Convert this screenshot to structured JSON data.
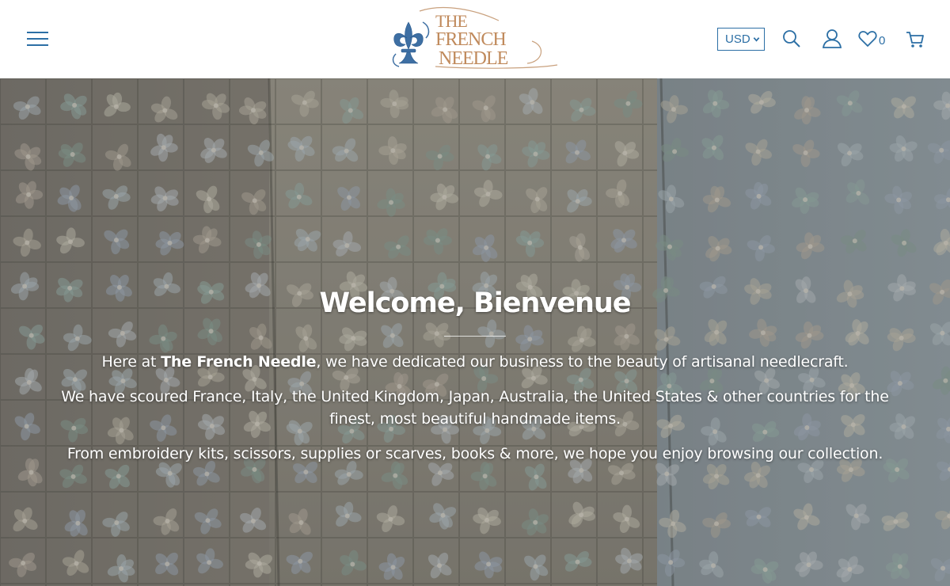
{
  "header": {
    "logo": {
      "line1": "THE",
      "line2": "FRENCH",
      "line3": "NEEDLE",
      "icon": "fleur-de-lis-icon"
    },
    "currency": {
      "selected": "USD"
    },
    "wishlist_count": "0",
    "icons": [
      "menu-icon",
      "search-icon",
      "account-icon",
      "heart-icon",
      "cart-icon"
    ]
  },
  "hero": {
    "title": "Welcome, Bienvenue",
    "paragraph1": {
      "prefix": "Here at ",
      "brand": "The French Needle",
      "suffix": ", we have dedicated our business to the beauty of artisanal needlecraft."
    },
    "paragraph2": "We have scoured France, Italy, the United Kingdom, Japan, Australia, the United States & other countries for the finest, most beautiful handmade items.",
    "paragraph3": "From embroidery kits, scissors, supplies or scarves, books & more, we hope you enjoy browsing our collection."
  },
  "colors": {
    "accent": "#2c6fa5",
    "logo_text": "#c08a5c",
    "hero_text": "#ffffff"
  }
}
